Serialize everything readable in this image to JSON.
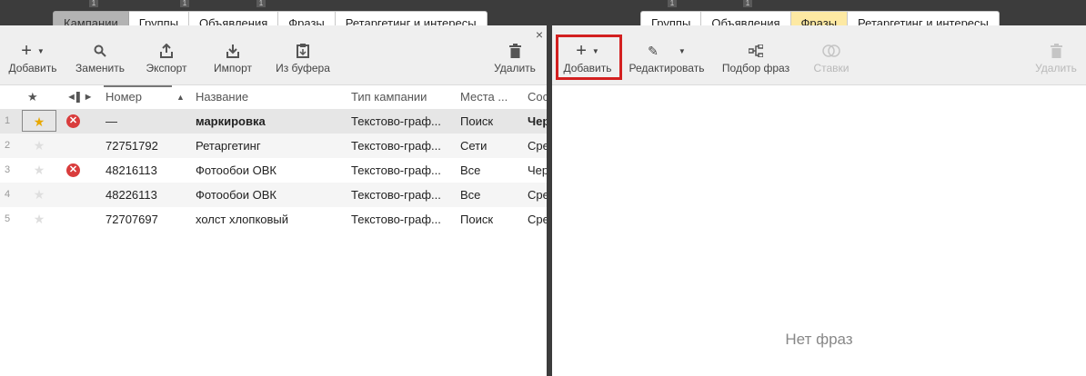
{
  "top_badges": [
    "1",
    "1",
    "1",
    "1",
    "1"
  ],
  "left": {
    "tabs": [
      "Кампании",
      "Группы",
      "Объявления",
      "Фразы",
      "Ретаргетинг и интересы"
    ],
    "toolbar": {
      "add": "Добавить",
      "replace": "Заменить",
      "export": "Экспорт",
      "import": "Импорт",
      "from_buffer": "Из буфера",
      "delete": "Удалить",
      "close": "×"
    },
    "columns": {
      "number": "Номер",
      "name": "Название",
      "type": "Тип кампании",
      "places": "Места ...",
      "status": "Сос"
    },
    "rows": [
      {
        "num": "1",
        "starred": true,
        "error": true,
        "number": "—",
        "name": "маркировка",
        "type": "Текстово-граф...",
        "places": "Поиск",
        "status": "Чер"
      },
      {
        "num": "2",
        "starred": false,
        "error": false,
        "number": "72751792",
        "name": "Ретаргетинг",
        "type": "Текстово-граф...",
        "places": "Сети",
        "status": "Сре"
      },
      {
        "num": "3",
        "starred": false,
        "error": true,
        "number": "48216113",
        "name": "Фотообои ОВК",
        "type": "Текстово-граф...",
        "places": "Все",
        "status": "Чер"
      },
      {
        "num": "4",
        "starred": false,
        "error": false,
        "number": "48226113",
        "name": "Фотообои ОВК",
        "type": "Текстово-граф...",
        "places": "Все",
        "status": "Сре"
      },
      {
        "num": "5",
        "starred": false,
        "error": false,
        "number": "72707697",
        "name": "холст хлопковый",
        "type": "Текстово-граф...",
        "places": "Поиск",
        "status": "Сре"
      }
    ]
  },
  "right": {
    "tabs": [
      "Группы",
      "Объявления",
      "Фразы",
      "Ретаргетинг и интересы"
    ],
    "toolbar": {
      "add": "Добавить",
      "edit": "Редактировать",
      "phrase_selection": "Подбор фраз",
      "bids": "Ставки",
      "delete": "Удалить"
    },
    "empty_message": "Нет фраз"
  },
  "colors": {
    "accent_yellow": "#fde9a3",
    "error_red": "#d93c3c",
    "star_gold": "#e8a800",
    "highlight_red": "#d32020"
  }
}
